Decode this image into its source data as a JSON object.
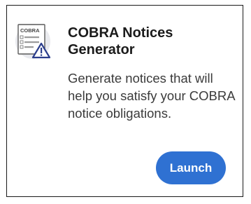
{
  "card": {
    "icon": {
      "name": "cobra-document-warning-icon",
      "label": "COBRA"
    },
    "title": "COBRA Notices Generator",
    "description": "Generate notices that will help you satisfy your COBRA notice obligations.",
    "launch_label": "Launch"
  },
  "colors": {
    "accent": "#2f71d2",
    "title": "#1b1b1b",
    "text": "#3b3b3b",
    "border": "#1a1a1a",
    "icon_circle": "#e9eaee",
    "warning": "#2c3e8c"
  }
}
